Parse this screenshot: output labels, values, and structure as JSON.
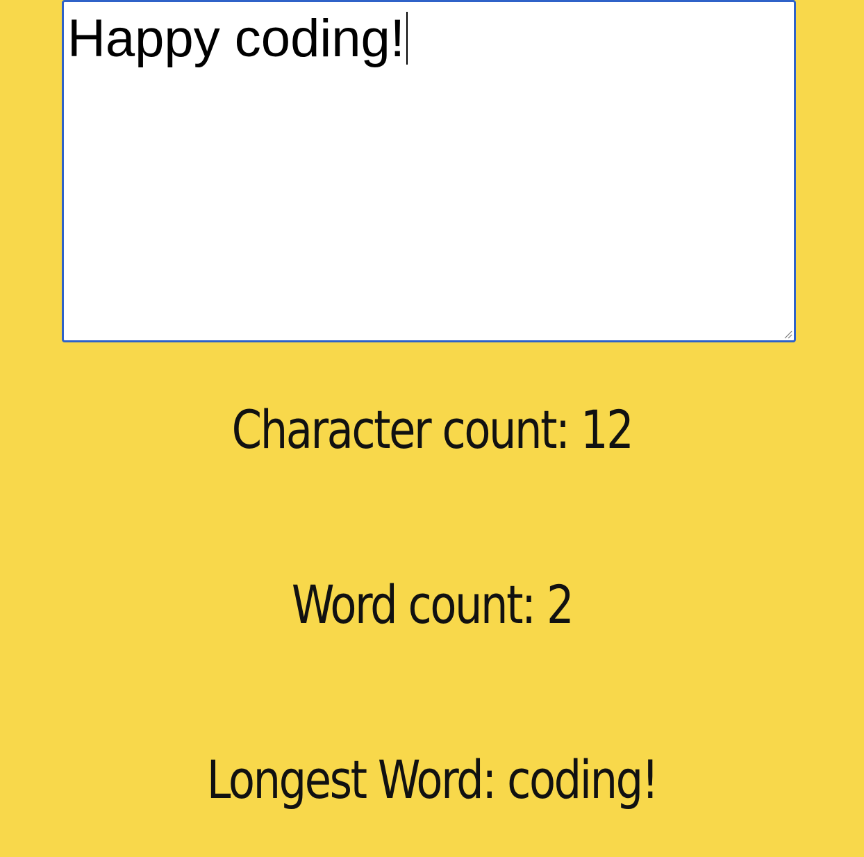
{
  "editor": {
    "value": "Happy coding!"
  },
  "stats": {
    "character_count": "Character count: 12",
    "word_count": "Word count: 2",
    "longest_word": "Longest Word: coding!"
  },
  "colors": {
    "background": "#F8D84B",
    "editor_border": "#2F62C8",
    "editor_background": "#FFFFFF",
    "text": "#111111"
  }
}
